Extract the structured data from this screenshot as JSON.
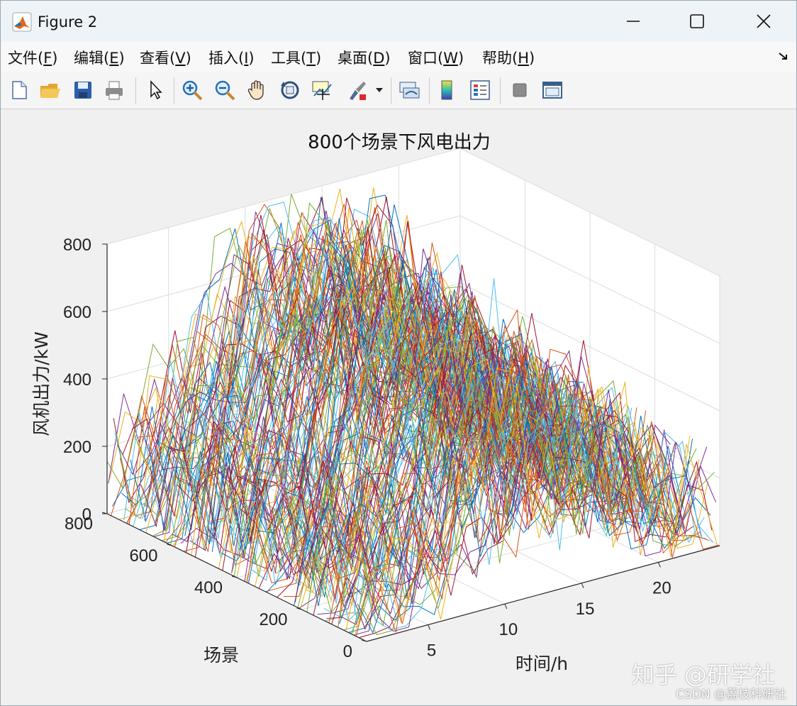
{
  "window": {
    "title": "Figure 2"
  },
  "menu": [
    {
      "label": "文件(",
      "key": "F",
      "end": ")"
    },
    {
      "label": "编辑(",
      "key": "E",
      "end": ")"
    },
    {
      "label": "查看(",
      "key": "V",
      "end": ")"
    },
    {
      "label": "插入(",
      "key": "I",
      "end": ")"
    },
    {
      "label": "工具(",
      "key": "T",
      "end": ")"
    },
    {
      "label": "桌面(",
      "key": "D",
      "end": ")"
    },
    {
      "label": "窗口(",
      "key": "W",
      "end": ")"
    },
    {
      "label": "帮助(",
      "key": "H",
      "end": ")"
    }
  ],
  "toolbar_icons": [
    "new-file-icon",
    "open-folder-icon",
    "save-icon",
    "print-icon",
    "pointer-icon",
    "zoom-in-icon",
    "zoom-out-icon",
    "pan-hand-icon",
    "rotate-3d-icon",
    "data-cursor-icon",
    "brush-icon",
    "link-plot-icon",
    "colorbar-icon",
    "legend-icon",
    "hide-tools-icon",
    "show-tools-icon"
  ],
  "chart_data": {
    "type": "line",
    "title": "800个场景下风电出力",
    "xlabel": "时间/h",
    "ylabel": "场景",
    "zlabel": "风机出力/kW",
    "x_ticks": [
      "5",
      "10",
      "15",
      "20"
    ],
    "y_ticks": [
      "0",
      "200",
      "400",
      "600",
      "800"
    ],
    "z_ticks": [
      "0",
      "200",
      "400",
      "600",
      "800"
    ],
    "xlim": [
      1,
      24
    ],
    "ylim": [
      0,
      800
    ],
    "zlim": [
      0,
      800
    ],
    "n_series": 800,
    "grid": true,
    "colors": [
      "#0072BD",
      "#D95319",
      "#EDB120",
      "#7E2F8E",
      "#77AC30",
      "#4DBEEE",
      "#A2142F"
    ]
  },
  "watermark": {
    "main": "知乎 @研学社",
    "sub": "CSDN @荔枝科研社"
  }
}
